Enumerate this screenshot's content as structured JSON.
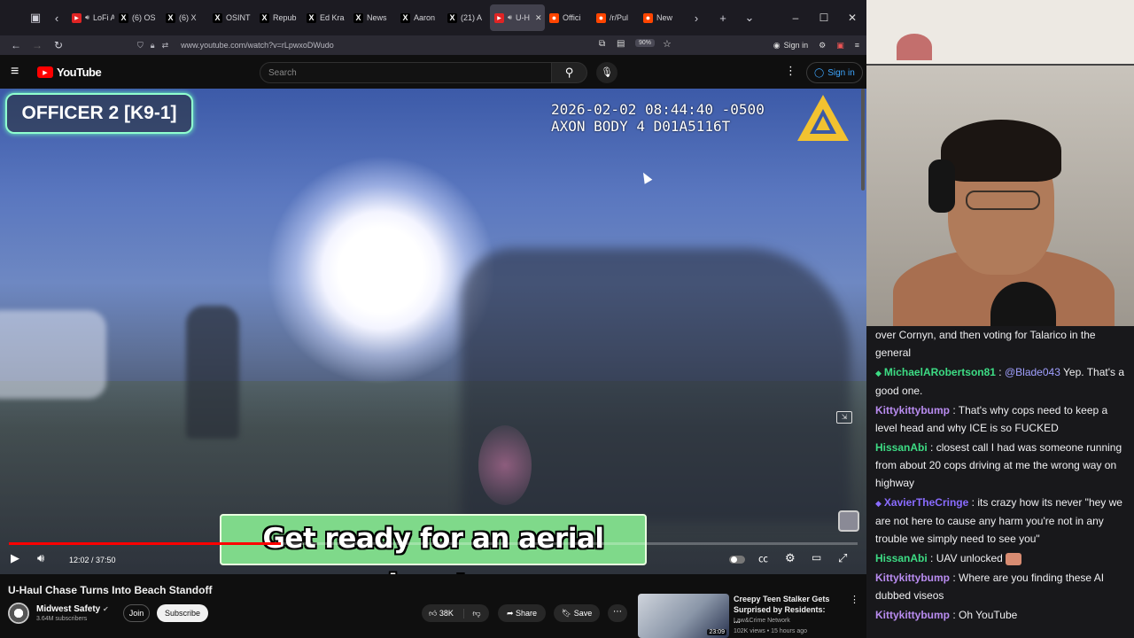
{
  "browser": {
    "tabs": [
      {
        "label": "LoFi A",
        "fav_color": "#e02424",
        "icon": "youtube-icon",
        "sound": true
      },
      {
        "label": "(6) OS",
        "fav_color": "#000000",
        "icon": "x-icon"
      },
      {
        "label": "(6) X",
        "fav_color": "#000000",
        "icon": "x-icon"
      },
      {
        "label": "OSINT",
        "fav_color": "#000000",
        "icon": "x-icon"
      },
      {
        "label": "Repub",
        "fav_color": "#000000",
        "icon": "x-icon"
      },
      {
        "label": "Ed Kra",
        "fav_color": "#000000",
        "icon": "x-icon"
      },
      {
        "label": "News",
        "fav_color": "#000000",
        "icon": "x-icon"
      },
      {
        "label": "Aaron",
        "fav_color": "#000000",
        "icon": "x-icon"
      },
      {
        "label": "(21) A",
        "fav_color": "#000000",
        "icon": "x-icon"
      },
      {
        "label": "U-H",
        "fav_color": "#e02424",
        "icon": "youtube-icon",
        "sound": true,
        "active": true
      },
      {
        "label": "Offici",
        "fav_color": "#ff4500",
        "icon": "reddit-icon"
      },
      {
        "label": "/r/Pul",
        "fav_color": "#ff4500",
        "icon": "reddit-icon"
      },
      {
        "label": "New",
        "fav_color": "#ff4500",
        "icon": "reddit-icon"
      }
    ],
    "url": "www.youtube.com/watch?v=rLpwxoDWudo",
    "zoom": "90%",
    "sign_in": "Sign in"
  },
  "youtube": {
    "logo_text": "YouTube",
    "search_placeholder": "Search",
    "sign_in": "Sign in",
    "overlay_officer": "OFFICER 2 [K9-1]",
    "overlay_timestamp": "2026-02-02 08:44:40 -0500",
    "overlay_device": "AXON BODY 4 D01A5116T",
    "subtitle": "Get ready for an aerial burst.",
    "progress": 0.32,
    "timecode": "12:02 / 37:50",
    "video_title": "U-Haul Chase Turns Into Beach Standoff",
    "channel_name": "Midwest Safety",
    "channel_subs": "3.64M subscribers",
    "join_label": "Join",
    "subscribe_label": "Subscribe",
    "likes": "38K",
    "share_label": "Share",
    "save_label": "Save",
    "recommended": {
      "title": "Creepy Teen Stalker Gets Surprised by Residents: ...",
      "channel": "Law&Crime Network",
      "meta": "102K views • 15 hours ago",
      "duration": "23:09"
    }
  },
  "chat": [
    {
      "user": "",
      "color": "#efeff1",
      "text": "over Cornyn, and then voting for Talarico in the general"
    },
    {
      "user": "MichaelARobertson81",
      "color": "#3ddc84",
      "badges": true,
      "mention": "@Blade043",
      "text": " Yep. That's a good one."
    },
    {
      "user": "Kittykittybump",
      "color": "#b98cf0",
      "text": "That's why cops need to keep a level head and why ICE is so FUCKED"
    },
    {
      "user": "HissanAbi",
      "color": "#3ddc84",
      "text": "closest call I had was someone running from about 20 cops driving at me the wrong way on highway"
    },
    {
      "user": "XavierTheCringe",
      "color": "#8a6cff",
      "badges": true,
      "text": "its crazy how its never \"hey we are not here to cause any harm you're not in any trouble we simply need to see you\""
    },
    {
      "user": "HissanAbi",
      "color": "#3ddc84",
      "text": "UAV unlocked",
      "emote": true
    },
    {
      "user": "Kittykittybump",
      "color": "#b98cf0",
      "text": "Where are you finding these AI dubbed viseos"
    },
    {
      "user": "Kittykittybump",
      "color": "#b98cf0",
      "text": "Oh YouTube"
    }
  ]
}
